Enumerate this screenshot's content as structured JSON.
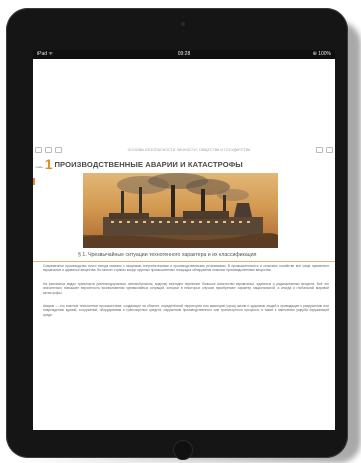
{
  "status_bar": {
    "carrier": "iPad ᯤ",
    "time": "09:28",
    "battery": "⊕ 100%"
  },
  "toolbar": {
    "title": "ОСНОВЫ БЕЗОПАСНОСТИ ЛИЧНОСТИ, ОБЩЕСТВА И ГОСУДАРСТВА"
  },
  "chapter": {
    "label": "глава",
    "number": "1",
    "title": "ПРОИЗВОДСТВЕННЫЕ АВАРИИ И КАТАСТРОФЫ"
  },
  "section": {
    "title": "§ 1. Чрезвычайные ситуации техногенного характера и их классификация"
  },
  "paragraphs": [
    "Современное производство почти всегда связано с мощными энергетическими и производственными установками. В промышленности и сельском хозяйстве всё чаще применяют взрывчатые и ядовитые вещества. Во многих странах вокруг крупных промышленных площадок обнаружены опасные производственные вещества.",
    "На различных видах транспорта (железнодорожном, автомобильном, водном) ежегодно перевозят большое количество взрывчатых, ядовитых и радиоактивных веществ. Всё это значительно повышает вероятность возникновения чрезвычайных ситуаций, которые в некоторых случаях приобретают характер национальной, а иногда и глобальной мировой катастрофы.",
    "Авария — это опасное техногенное происшествие, создающее на объекте, определённой территории или акватории угрозу жизни и здоровью людей и приводящее к разрушению или повреждению зданий, сооружений, оборудования и транспортных средств, нарушению производственного или транспортного процесса, а также к нанесению ущерба окружающей среде."
  ],
  "colors": {
    "accent": "#e58a1f",
    "device_frame": "#151515",
    "body_text": "#666666"
  }
}
